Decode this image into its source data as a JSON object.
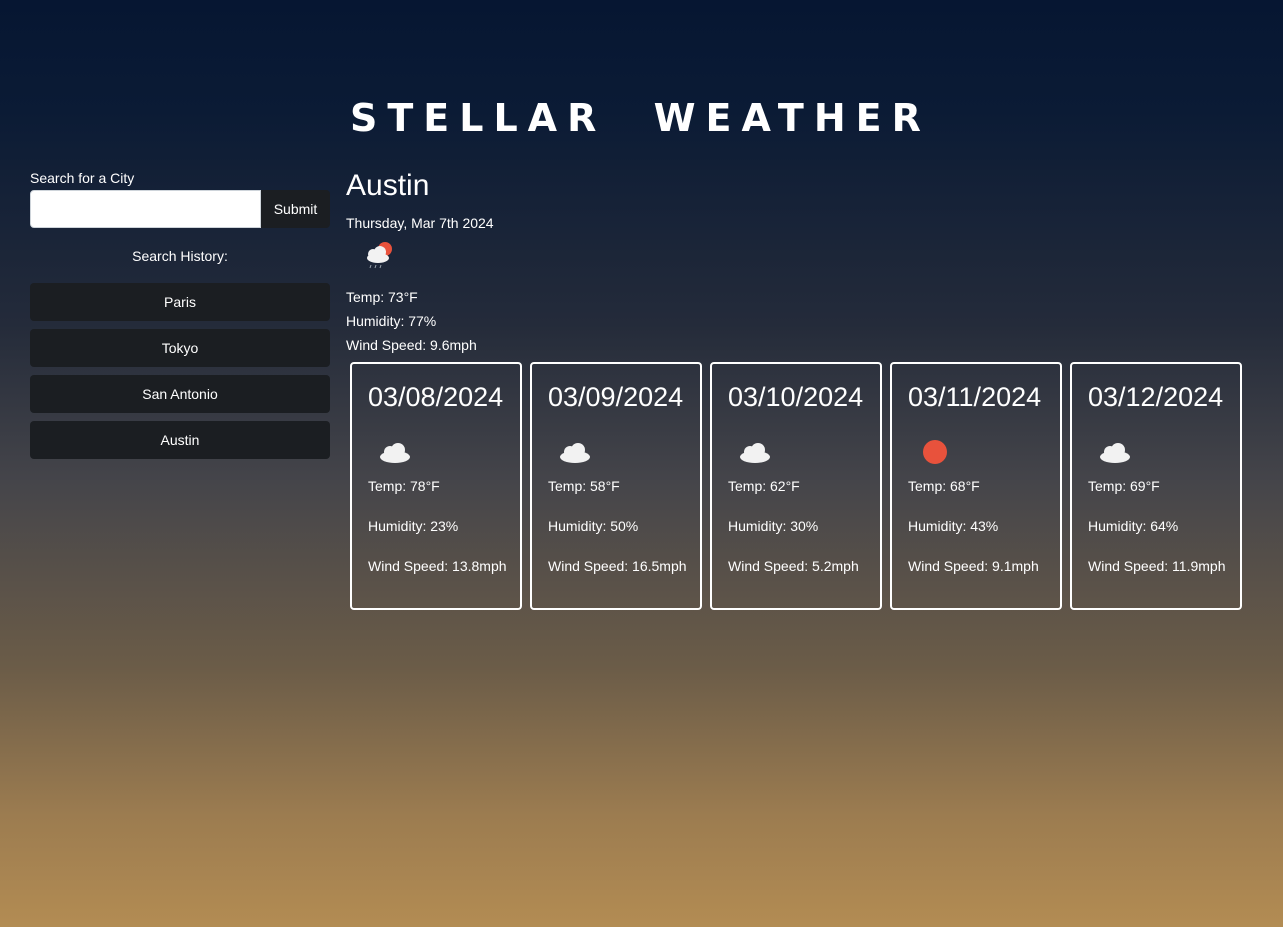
{
  "header": {
    "title": "STELLAR WEATHER"
  },
  "search": {
    "label": "Search for a City",
    "value": "",
    "submit_label": "Submit"
  },
  "history": {
    "label": "Search History:",
    "items": [
      "Paris",
      "Tokyo",
      "San Antonio",
      "Austin"
    ]
  },
  "current": {
    "city": "Austin",
    "date": "Thursday, Mar 7th 2024",
    "icon": "cloud-sun-rain-icon",
    "temp": "Temp: 73°F",
    "humidity": "Humidity: 77%",
    "wind": "Wind Speed: 9.6mph"
  },
  "forecast": [
    {
      "date": "03/08/2024",
      "icon": "cloud-icon",
      "temp": "Temp: 78°F",
      "humidity": "Humidity: 23%",
      "wind": "Wind Speed: 13.8mph"
    },
    {
      "date": "03/09/2024",
      "icon": "cloud-icon",
      "temp": "Temp: 58°F",
      "humidity": "Humidity: 50%",
      "wind": "Wind Speed: 16.5mph"
    },
    {
      "date": "03/10/2024",
      "icon": "cloud-icon",
      "temp": "Temp: 62°F",
      "humidity": "Humidity: 30%",
      "wind": "Wind Speed: 5.2mph"
    },
    {
      "date": "03/11/2024",
      "icon": "sun-icon",
      "temp": "Temp: 68°F",
      "humidity": "Humidity: 43%",
      "wind": "Wind Speed: 9.1mph"
    },
    {
      "date": "03/12/2024",
      "icon": "cloud-icon",
      "temp": "Temp: 69°F",
      "humidity": "Humidity: 64%",
      "wind": "Wind Speed: 11.9mph"
    }
  ],
  "colors": {
    "sun": "#e8523c",
    "cloud": "#f2f2f2",
    "button": "#1b1e22"
  }
}
